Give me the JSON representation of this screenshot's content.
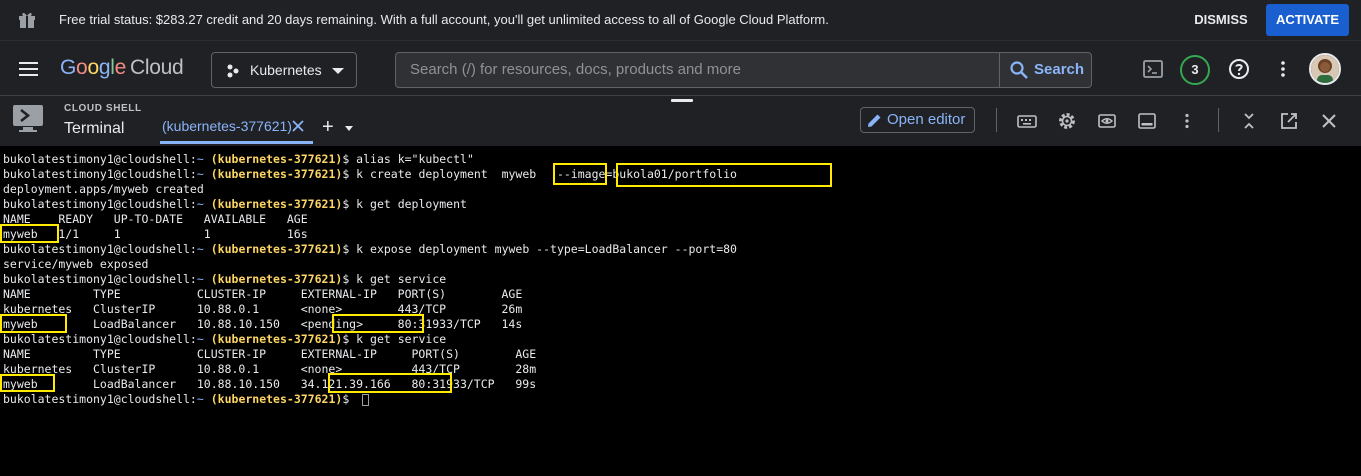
{
  "banner": {
    "message": "Free trial status: $283.27 credit and 20 days remaining. With a full account, you'll get unlimited access to all of Google Cloud Platform.",
    "dismiss_label": "DISMISS",
    "activate_label": "ACTIVATE",
    "icon": "gift-icon"
  },
  "topbar": {
    "logo": {
      "g1": "G",
      "g2": "o",
      "g3": "o",
      "g4": "g",
      "g5": "l",
      "g6": "e",
      "cloud": "Cloud"
    },
    "project": "Kubernetes",
    "search_placeholder": "Search (/) for resources, docs, products and more",
    "search_button": "Search",
    "notifications_count": "3",
    "icons": [
      "menu-icon",
      "project-dots-icon",
      "search-icon",
      "cloud-shell-icon",
      "help-icon",
      "more-vert-icon"
    ]
  },
  "shell": {
    "section_label": "CLOUD SHELL",
    "title": "Terminal",
    "tab_label": "(kubernetes-377621)",
    "add_tab": "+",
    "open_editor_label": "Open editor",
    "icons": [
      "keyboard-icon",
      "settings-icon",
      "web-preview-icon",
      "minimize-panel-icon",
      "more-vert-icon",
      "collapse-icon",
      "open-new-window-icon",
      "close-icon"
    ]
  },
  "terminal": {
    "prompt_user": "bukolatestimony1@cloudshell:",
    "prompt_path": "~",
    "prompt_context": "(kubernetes-377621)",
    "lines": [
      {
        "type": "cmd",
        "text": "alias k=\"kubectl\""
      },
      {
        "type": "cmd",
        "text": "k create deployment  myweb   --image=bukola01/portfolio"
      },
      {
        "type": "out",
        "text": "deployment.apps/myweb created"
      },
      {
        "type": "cmd",
        "text": "k get deployment"
      },
      {
        "type": "out",
        "text": "NAME    READY   UP-TO-DATE   AVAILABLE   AGE"
      },
      {
        "type": "out",
        "text": "myweb   1/1     1            1           16s"
      },
      {
        "type": "cmd",
        "text": "k expose deployment myweb --type=LoadBalancer --port=80"
      },
      {
        "type": "out",
        "text": "service/myweb exposed"
      },
      {
        "type": "cmd",
        "text": "k get service"
      },
      {
        "type": "out",
        "text": "NAME         TYPE           CLUSTER-IP     EXTERNAL-IP   PORT(S)        AGE"
      },
      {
        "type": "out",
        "text": "kubernetes   ClusterIP      10.88.0.1      <none>        443/TCP        26m"
      },
      {
        "type": "out",
        "text": "myweb        LoadBalancer   10.88.10.150   <pending>     80:31933/TCP   14s"
      },
      {
        "type": "cmd",
        "text": "k get service"
      },
      {
        "type": "out",
        "text": "NAME         TYPE           CLUSTER-IP     EXTERNAL-IP     PORT(S)        AGE"
      },
      {
        "type": "out",
        "text": "kubernetes   ClusterIP      10.88.0.1      <none>          443/TCP        28m"
      },
      {
        "type": "out",
        "text": "myweb        LoadBalancer   10.88.10.150   34.121.39.166   80:31933/TCP   99s"
      },
      {
        "type": "cmd",
        "text": ""
      }
    ]
  },
  "colors": {
    "accent": "#8ab4f8",
    "activate_bg": "#1a5fd0",
    "prompt_context": "#fdd663",
    "highlight_box": "#ffea00",
    "notification_ring": "#34a853"
  }
}
